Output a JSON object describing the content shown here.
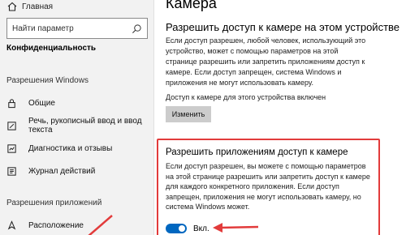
{
  "sidebar": {
    "home_label": "Главная",
    "search_placeholder": "Найти параметр",
    "section_title": "Конфиденциальность",
    "windows_permissions_title": "Разрешения Windows",
    "windows_items": [
      {
        "label": "Общие",
        "icon": "lock-icon"
      },
      {
        "label": "Речь, рукописный ввод и ввод текста",
        "icon": "speech-icon"
      },
      {
        "label": "Диагностика и отзывы",
        "icon": "diagnostics-icon"
      },
      {
        "label": "Журнал действий",
        "icon": "activity-history-icon"
      }
    ],
    "app_permissions_title": "Разрешения приложений",
    "app_items": [
      {
        "label": "Расположение",
        "icon": "location-icon"
      }
    ]
  },
  "main": {
    "page_title": "Камера",
    "device_access_title": "Разрешить доступ к камере на этом устройстве",
    "device_access_desc": "Если доступ разрешен, любой человек, использующий это устройство, может с помощью параметров на этой странице разрешить или запретить приложениям доступ к камере. Если доступ запрещен, система Windows и приложения не могут использовать камеру.",
    "device_status": "Доступ к камере для этого устройства включен",
    "change_button": "Изменить",
    "apps_access_title": "Разрешить приложениям доступ к камере",
    "apps_access_desc": "Если доступ разрешен, вы можете с помощью параметров на этой странице разрешить или запретить доступ к камере для каждого конкретного приложения. Если доступ запрещен, приложения не могут использовать камеру, но система Windows может.",
    "toggle_label": "Вкл.",
    "toggle_on": true
  },
  "colors": {
    "accent": "#0067c0",
    "annotation": "#e23b3b",
    "sidebar_bg": "#f2f2f2"
  }
}
